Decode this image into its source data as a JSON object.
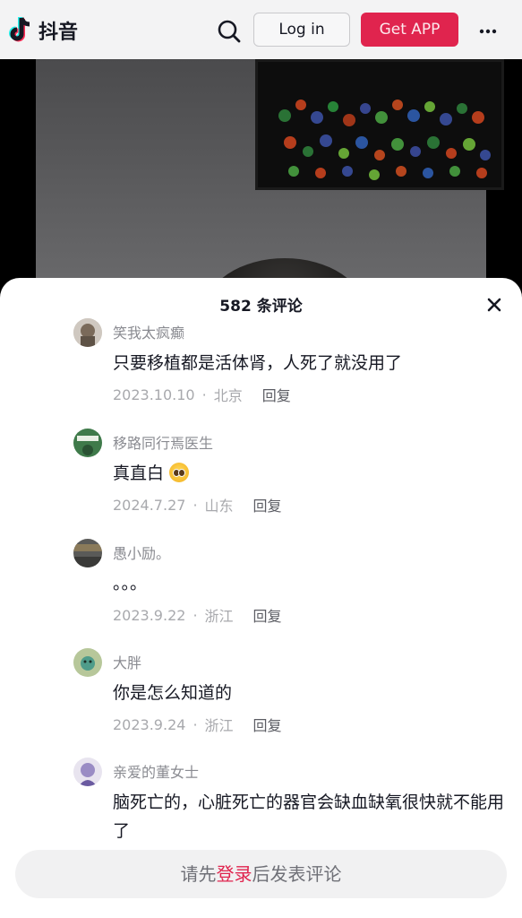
{
  "app": {
    "name": "抖音",
    "logo_icon": "douyin-logo-icon"
  },
  "header": {
    "login_label": "Log in",
    "get_app_label": "Get APP",
    "accent": "#e0244e"
  },
  "comments_panel": {
    "title": "582 条评论",
    "reply_label": "回复",
    "items": [
      {
        "user": "笑我太疯癫",
        "text": "只要移植都是活体肾，人死了就没用了",
        "date": "2023.10.10",
        "location": "北京"
      },
      {
        "user": "移路同行焉医生",
        "text": "真直白",
        "emoji": "pleading-face-emoji",
        "date": "2024.7.27",
        "location": "山东"
      },
      {
        "user": "愚小励。",
        "text": "。。。",
        "date": "2023.9.22",
        "location": "浙江"
      },
      {
        "user": "大胖",
        "text": "你是怎么知道的",
        "date": "2023.9.24",
        "location": "浙江"
      },
      {
        "user": "亲爱的董女士",
        "text": "脑死亡的，心脏死亡的器官会缺血缺氧很快就不能用了"
      }
    ]
  },
  "comment_input": {
    "prefix": "请先",
    "link": "登录",
    "suffix": "后发表评论"
  }
}
